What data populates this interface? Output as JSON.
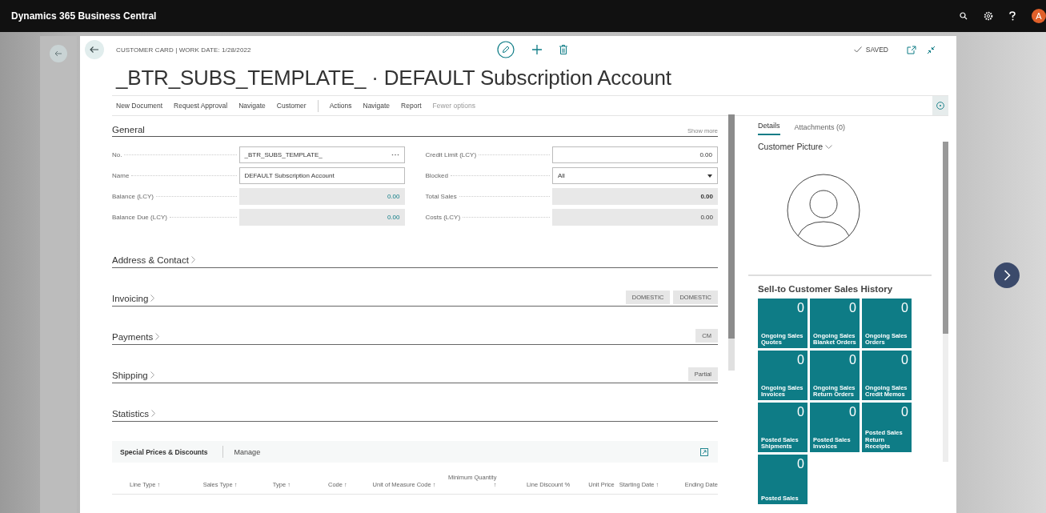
{
  "app_bar": {
    "title": "Dynamics 365 Business Central",
    "avatar": "A"
  },
  "page": {
    "breadcrumb": "CUSTOMER CARD | WORK DATE: 1/28/2022",
    "title": "_BTR_SUBS_TEMPLATE_ · DEFAULT Subscription Account",
    "status": "SAVED"
  },
  "actions": [
    {
      "label": "New Document",
      "divider_before": false,
      "muted": false
    },
    {
      "label": "Request Approval",
      "divider_before": false,
      "muted": false
    },
    {
      "label": "Navigate",
      "divider_before": false,
      "muted": false
    },
    {
      "label": "Customer",
      "divider_before": false,
      "muted": false
    },
    {
      "label": "Actions",
      "divider_before": true,
      "muted": false
    },
    {
      "label": "Navigate",
      "divider_before": false,
      "muted": false
    },
    {
      "label": "Report",
      "divider_before": false,
      "muted": false
    },
    {
      "label": "Fewer options",
      "divider_before": false,
      "muted": true
    }
  ],
  "general": {
    "title": "General",
    "show_more": "Show more",
    "rows": [
      [
        {
          "label": "No.",
          "value": "_BTR_SUBS_TEMPLATE_",
          "kind": "lookup"
        },
        {
          "label": "Credit Limit (LCY)",
          "value": "0.00",
          "kind": "number"
        }
      ],
      [
        {
          "label": "Name",
          "value": "DEFAULT Subscription Account",
          "kind": "text"
        },
        {
          "label": "Blocked",
          "value": "All",
          "kind": "select"
        }
      ],
      [
        {
          "label": "Balance (LCY)",
          "value": "0.00",
          "kind": "readonly",
          "link": true,
          "bold": false
        },
        {
          "label": "Total Sales",
          "value": "0.00",
          "kind": "readonly",
          "link": false,
          "bold": true
        }
      ],
      [
        {
          "label": "Balance Due (LCY)",
          "value": "0.00",
          "kind": "readonly",
          "link": true,
          "bold": false
        },
        {
          "label": "Costs (LCY)",
          "value": "0.00",
          "kind": "readonly",
          "link": false,
          "bold": false
        }
      ]
    ]
  },
  "sections": [
    {
      "title": "Address & Contact"
    },
    {
      "title": "Invoicing",
      "badges": [
        "DOMESTIC",
        "DOMESTIC"
      ]
    },
    {
      "title": "Payments",
      "badges": [
        "CM"
      ]
    },
    {
      "title": "Shipping",
      "badges": [
        "Partial"
      ]
    },
    {
      "title": "Statistics"
    }
  ],
  "subpage": {
    "title": "Special Prices & Discounts",
    "action": "Manage",
    "columns": [
      "Line Type ↑",
      "Sales Type ↑",
      "Type ↑",
      "Code ↑",
      "Unit of Measure Code ↑",
      "Minimum Quantity ↑",
      "Line Discount %",
      "Unit Price",
      "Starting Date ↑",
      "Ending Date"
    ]
  },
  "factbox": {
    "tabs": [
      {
        "label": "Details",
        "selected": true
      },
      {
        "label": "Attachments (0)",
        "selected": false
      }
    ],
    "picture_title": "Customer Picture",
    "history_title": "Sell-to Customer Sales History",
    "tiles": [
      {
        "count": "0",
        "label": "Ongoing Sales Quotes"
      },
      {
        "count": "0",
        "label": "Ongoing Sales Blanket Orders"
      },
      {
        "count": "0",
        "label": "Ongoing Sales Orders"
      },
      {
        "count": "0",
        "label": "Ongoing Sales Invoices"
      },
      {
        "count": "0",
        "label": "Ongoing Sales Return Orders"
      },
      {
        "count": "0",
        "label": "Ongoing Sales Credit Memos"
      },
      {
        "count": "0",
        "label": "Posted Sales Shipments"
      },
      {
        "count": "0",
        "label": "Posted Sales Invoices"
      },
      {
        "count": "0",
        "label": "Posted Sales Return Receipts"
      },
      {
        "count": "0",
        "label": "Posted Sales"
      }
    ]
  }
}
